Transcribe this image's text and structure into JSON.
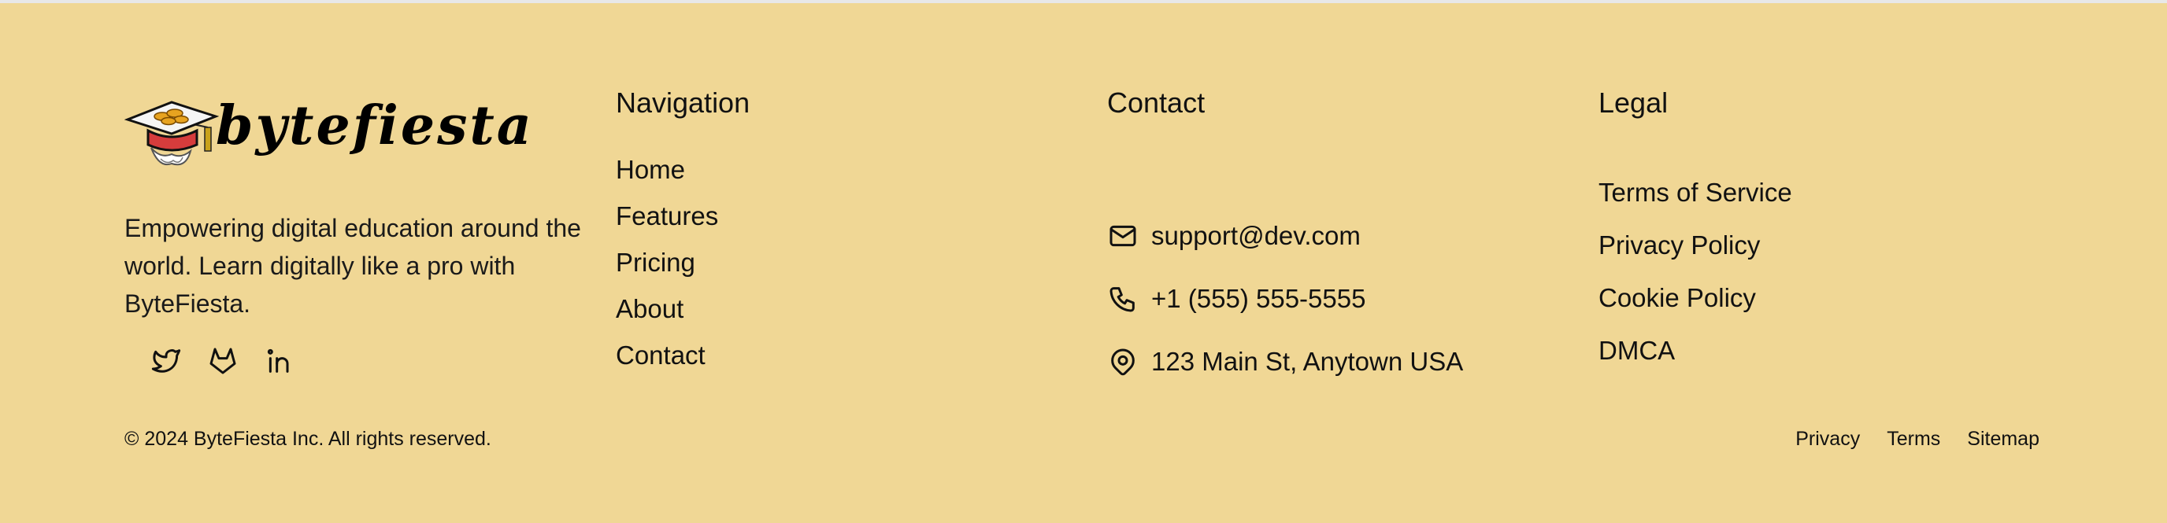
{
  "brand": {
    "logo_text": "bytefiesta",
    "tagline": "Empowering digital education around the world. Learn digitally like a pro with ByteFiesta.",
    "socials": [
      {
        "icon": "twitter-icon"
      },
      {
        "icon": "gitlab-icon"
      },
      {
        "icon": "linkedin-icon"
      }
    ]
  },
  "navigation": {
    "heading": "Navigation",
    "items": [
      "Home",
      "Features",
      "Pricing",
      "About",
      "Contact"
    ]
  },
  "contact": {
    "heading": "Contact",
    "email": "support@dev.com",
    "phone": "+1 (555) 555-5555",
    "address": "123 Main St, Anytown USA"
  },
  "legal": {
    "heading": "Legal",
    "items": [
      "Terms of Service",
      "Privacy Policy",
      "Cookie Policy",
      "DMCA"
    ]
  },
  "footer": {
    "copyright": "© 2024 ByteFiesta Inc. All rights reserved.",
    "links": [
      "Privacy",
      "Terms",
      "Sitemap"
    ]
  },
  "colors": {
    "background": "#f0d795",
    "text": "#111111"
  }
}
